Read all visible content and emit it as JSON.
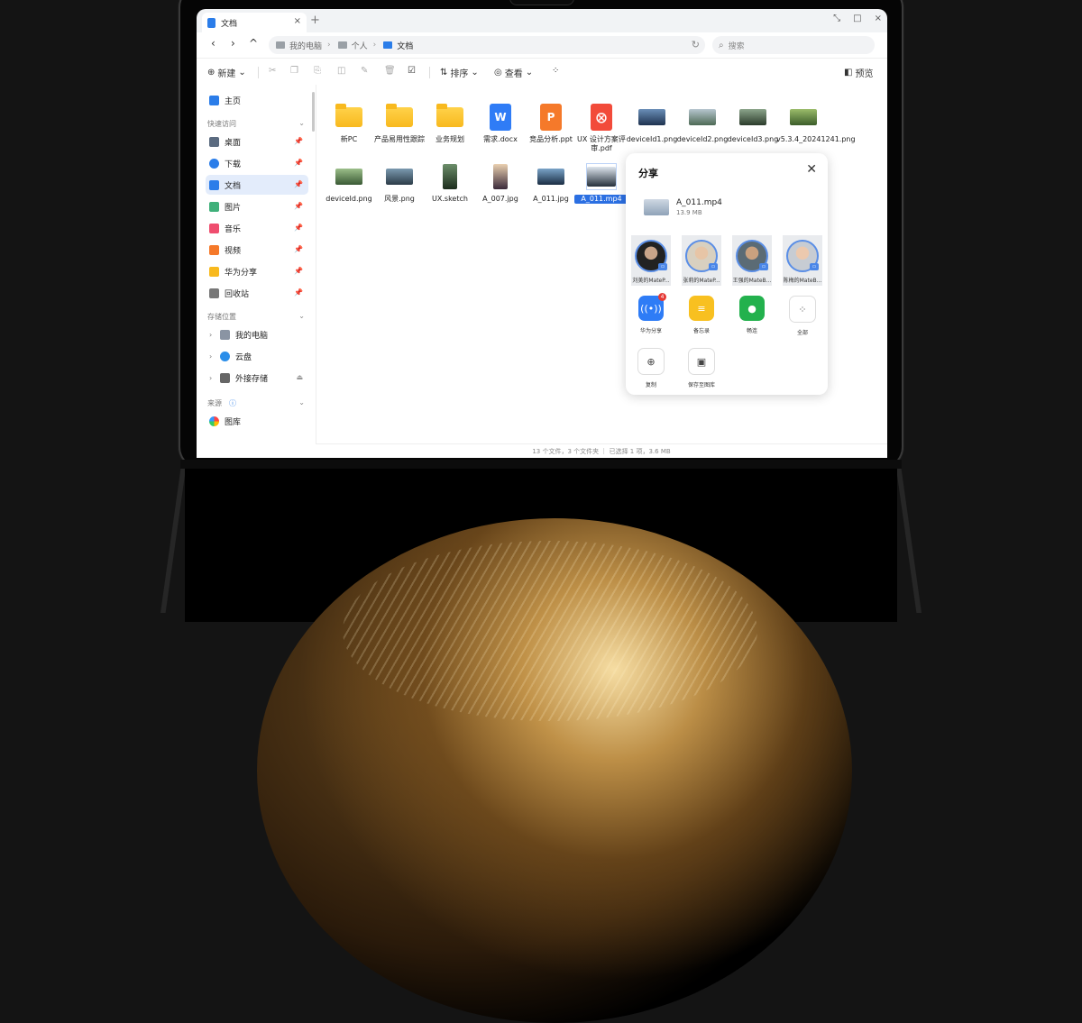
{
  "tab": {
    "title": "文档",
    "close": "×",
    "add": "+"
  },
  "window_controls": {
    "restore": "⤡",
    "maximize": "□",
    "close": "×"
  },
  "address": {
    "crumbs": [
      "我的电脑",
      "个人",
      "文档"
    ],
    "search_placeholder": "搜索"
  },
  "toolbar": {
    "new_label": "新建",
    "sort_label": "排序",
    "view_label": "查看",
    "preview_label": "预览"
  },
  "sidebar": {
    "home": "主页",
    "quick_access_title": "快速访问",
    "quick_items": [
      "桌面",
      "下载",
      "文档",
      "图片",
      "音乐",
      "视频",
      "华为分享",
      "回收站"
    ],
    "storage_title": "存储位置",
    "storage_items": [
      "我的电脑",
      "云盘",
      "外接存储"
    ],
    "source_title": "来源",
    "source_items": [
      "图库"
    ]
  },
  "files": [
    {
      "name": "新PC",
      "type": "folder"
    },
    {
      "name": "产品易用性跟踪",
      "type": "folder"
    },
    {
      "name": "业务规划",
      "type": "folder"
    },
    {
      "name": "需求.docx",
      "type": "word",
      "glyph": "W"
    },
    {
      "name": "竞品分析.ppt",
      "type": "ppt",
      "glyph": "P"
    },
    {
      "name": "UX 设计方案评审.pdf",
      "type": "pdf",
      "glyph": "⨂"
    },
    {
      "name": "deviceId1.png",
      "type": "image"
    },
    {
      "name": "deviceId2.png",
      "type": "image"
    },
    {
      "name": "deviceId3.png",
      "type": "image"
    },
    {
      "name": "v5.3.4_20241241.png",
      "type": "image"
    },
    {
      "name": "deviceId.png",
      "type": "image"
    },
    {
      "name": "风景.png",
      "type": "image"
    },
    {
      "name": "UX.sketch",
      "type": "image-portrait"
    },
    {
      "name": "A_007.jpg",
      "type": "image-portrait"
    },
    {
      "name": "A_011.jpg",
      "type": "image"
    },
    {
      "name": "A_011.mp4",
      "type": "video",
      "selected": true
    }
  ],
  "status": "13 个文件，3 个文件夹 ｜ 已选择 1 项，3.6 MB",
  "share": {
    "title": "分享",
    "file_name": "A_011.mp4",
    "file_size": "13.9 MB",
    "contacts": [
      "刘美的MateP...",
      "张莉的MateP...",
      "王强的MateB...",
      "陈梅的MateB..."
    ],
    "apps": [
      {
        "label": "华为分享",
        "badge": "4"
      },
      {
        "label": "备忘录"
      },
      {
        "label": "畅连"
      },
      {
        "label": "全部"
      }
    ],
    "actions": [
      "复制",
      "保存至图库"
    ]
  },
  "colors": {
    "accent": "#2b6fe2",
    "folder": "#f8b91e",
    "word": "#2f7cf6",
    "ppt": "#f5792a",
    "pdf": "#f24b3a"
  }
}
